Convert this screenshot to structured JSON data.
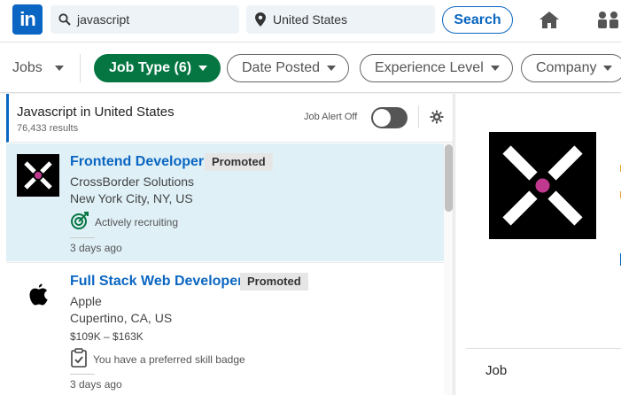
{
  "header": {
    "logo_text": "in",
    "search_keywords": "javascript",
    "search_location": "United States",
    "search_button": "Search",
    "nav_icons": [
      "home-icon",
      "my-network-icon"
    ]
  },
  "filters": {
    "jobs_label": "Jobs",
    "pills": [
      {
        "label": "Job Type (6)",
        "active": true
      },
      {
        "label": "Date Posted",
        "active": false
      },
      {
        "label": "Experience Level",
        "active": false
      },
      {
        "label": "Company",
        "active": false
      }
    ]
  },
  "results": {
    "title": "Javascript in United States",
    "count": "76,433 results",
    "job_alert_label": "Job Alert Off",
    "job_alert_on": false
  },
  "jobs": [
    {
      "title": "Frontend Developer",
      "badge": "Promoted",
      "company": "CrossBorder Solutions",
      "location": "New York City, NY, US",
      "insight": "Actively recruiting",
      "insight_icon": "target-icon",
      "posted": "3 days ago",
      "logo": "crossborder-logo",
      "selected": true
    },
    {
      "title": "Full Stack Web Developer",
      "badge": "Promoted",
      "company": "Apple",
      "location": "Cupertino, CA, US",
      "salary": "$109K – $163K",
      "insight": "You have a preferred skill badge",
      "insight_icon": "clipboard-check-icon",
      "posted": "3 days ago",
      "logo": "apple-logo",
      "selected": false
    }
  ],
  "detail": {
    "section_label": "Job"
  },
  "colors": {
    "brand": "#0a66c2",
    "active_pill": "#057642",
    "selected_card": "#dff0f7",
    "crossborder_dot": "#c0398f"
  }
}
